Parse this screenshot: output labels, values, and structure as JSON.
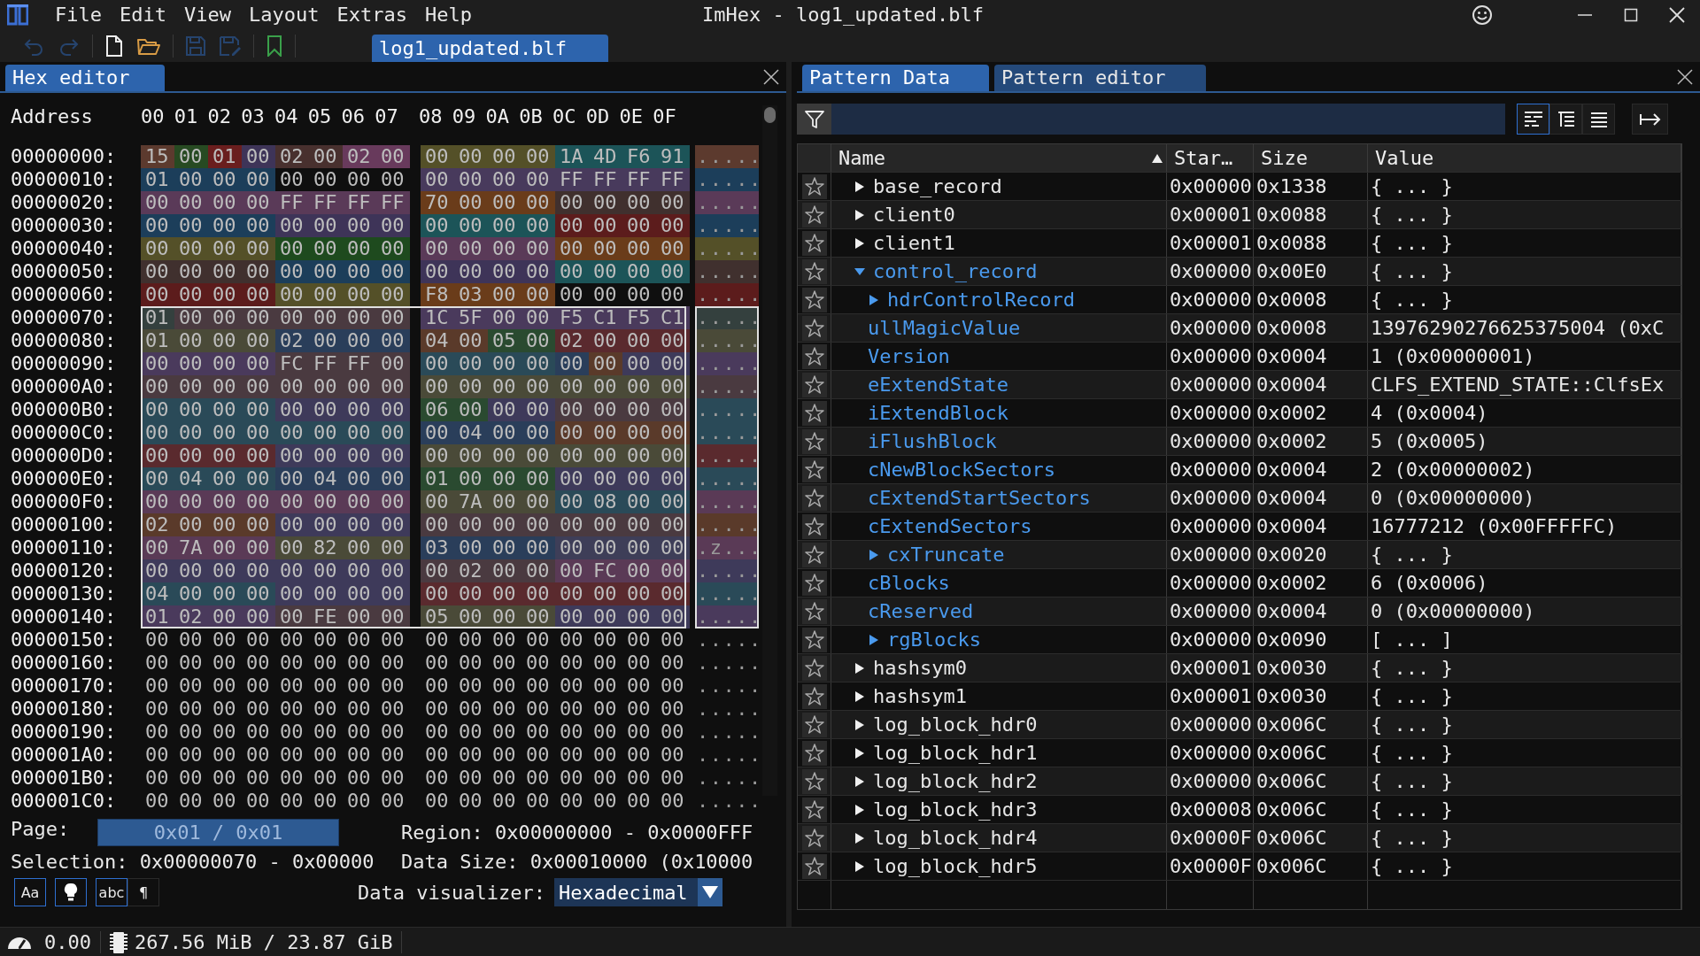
{
  "app": {
    "menu": [
      "File",
      "Edit",
      "View",
      "Layout",
      "Extras",
      "Help"
    ],
    "title": "ImHex - log1_updated.blf"
  },
  "toolbar": {
    "file_tab": "log1_updated.blf"
  },
  "hex_editor": {
    "tab": "Hex editor",
    "address_label": "Address",
    "columns": [
      "00",
      "01",
      "02",
      "03",
      "04",
      "05",
      "06",
      "07",
      "08",
      "09",
      "0A",
      "0B",
      "0C",
      "0D",
      "0E",
      "0F"
    ],
    "rows": [
      {
        "address": "00000000:",
        "selected": false,
        "ascii": ".....",
        "segments": [
          {
            "color": "#5c3a2e",
            "bytes": [
              "15"
            ]
          },
          {
            "color": "#274a22",
            "bytes": [
              "00"
            ]
          },
          {
            "color": "#6a1e1e",
            "bytes": [
              "01"
            ]
          },
          {
            "color": "#3e3458",
            "bytes": [
              "00"
            ]
          },
          {
            "color": "#48302e",
            "bytes": [
              "02",
              "00"
            ]
          },
          {
            "color": "#683a5c",
            "bytes": [
              "02",
              "00"
            ]
          },
          {
            "color": "#545028",
            "bytes": [
              "00",
              "00",
              "00",
              "00"
            ]
          },
          {
            "color": "#1c5458",
            "bytes": [
              "1A",
              "4D",
              "F6",
              "91"
            ]
          }
        ]
      },
      {
        "address": "00000010:",
        "selected": false,
        "ascii": ".....",
        "segments": [
          {
            "color": "#1c3e5a",
            "bytes": [
              "01",
              "00",
              "00",
              "00"
            ]
          },
          {
            "bytes": [
              "00",
              "00",
              "00",
              "00"
            ]
          },
          {
            "color": "#483a5c",
            "bytes": [
              "00",
              "00",
              "00",
              "00",
              "FF",
              "FF",
              "FF",
              "FF"
            ]
          }
        ]
      },
      {
        "address": "00000020:",
        "selected": false,
        "ascii": ".....",
        "segments": [
          {
            "color": "#5a3a58",
            "bytes": [
              "00",
              "00",
              "00",
              "00",
              "FF",
              "FF",
              "FF",
              "FF"
            ]
          },
          {
            "color": "#6a3c1a",
            "bytes": [
              "70",
              "00",
              "00",
              "00"
            ]
          },
          {
            "color": "#40302e",
            "bytes": [
              "00",
              "00",
              "00",
              "00"
            ]
          }
        ]
      },
      {
        "address": "00000030:",
        "selected": false,
        "ascii": ".....",
        "segments": [
          {
            "color": "#1c3e5a",
            "bytes": [
              "00",
              "00",
              "00",
              "00"
            ]
          },
          {
            "color": "#3e3458",
            "bytes": [
              "00",
              "00",
              "00",
              "00"
            ]
          },
          {
            "color": "#1c5458",
            "bytes": [
              "00",
              "00",
              "00",
              "00"
            ]
          },
          {
            "color": "#5c1c1c",
            "bytes": [
              "00",
              "00",
              "00",
              "00"
            ]
          }
        ]
      },
      {
        "address": "00000040:",
        "selected": false,
        "ascii": ".....",
        "segments": [
          {
            "color": "#545028",
            "bytes": [
              "00",
              "00",
              "00",
              "00"
            ]
          },
          {
            "color": "#1e4a1e",
            "bytes": [
              "00",
              "00",
              "00",
              "00"
            ]
          },
          {
            "color": "#5a3a58",
            "bytes": [
              "00",
              "00",
              "00",
              "00"
            ]
          },
          {
            "color": "#6a3c1a",
            "bytes": [
              "00",
              "00",
              "00",
              "00"
            ]
          }
        ]
      },
      {
        "address": "00000050:",
        "selected": false,
        "ascii": ".....",
        "segments": [
          {
            "color": "#40302e",
            "bytes": [
              "00",
              "00",
              "00",
              "00"
            ]
          },
          {
            "color": "#1c3e5a",
            "bytes": [
              "00",
              "00",
              "00",
              "00"
            ]
          },
          {
            "color": "#3e3458",
            "bytes": [
              "00",
              "00",
              "00",
              "00"
            ]
          },
          {
            "color": "#1c5458",
            "bytes": [
              "00",
              "00",
              "00",
              "00"
            ]
          }
        ]
      },
      {
        "address": "00000060:",
        "selected": false,
        "ascii": ".....",
        "segments": [
          {
            "color": "#5c1c1c",
            "bytes": [
              "00",
              "00",
              "00",
              "00"
            ]
          },
          {
            "color": "#545028",
            "bytes": [
              "00",
              "00",
              "00",
              "00"
            ]
          },
          {
            "color": "#6a3c1a",
            "bytes": [
              "F8",
              "03",
              "00",
              "00"
            ]
          },
          {
            "bytes": [
              "00",
              "00",
              "00",
              "00"
            ]
          }
        ]
      },
      {
        "address": "00000070:",
        "selected": true,
        "ascii": ".....",
        "segments": [
          {
            "color": "#34403e",
            "bytes": [
              "01"
            ]
          },
          {
            "color": "#4a3a40",
            "bytes": [
              "00",
              "00",
              "00",
              "00",
              "00",
              "00",
              "00"
            ]
          },
          {
            "color": "#4a3a5c",
            "bytes": [
              "1C",
              "5F",
              "00",
              "00",
              "F5",
              "C1",
              "F5",
              "C1"
            ]
          }
        ]
      },
      {
        "address": "00000080:",
        "selected": true,
        "ascii": ".....",
        "segments": [
          {
            "color": "#4a4a38",
            "bytes": [
              "01",
              "00",
              "00",
              "00"
            ]
          },
          {
            "color": "#2a3e5a",
            "bytes": [
              "02",
              "00",
              "00",
              "00"
            ]
          },
          {
            "color": "#5a3a2a",
            "bytes": [
              "04",
              "00"
            ]
          },
          {
            "color": "#2a4a30",
            "bytes": [
              "05",
              "00"
            ]
          },
          {
            "color": "#5a2a2e",
            "bytes": [
              "02",
              "00",
              "00",
              "00"
            ]
          }
        ]
      },
      {
        "address": "00000090:",
        "selected": true,
        "ascii": ".....",
        "segments": [
          {
            "color": "#4a3a5c",
            "bytes": [
              "00",
              "00",
              "00",
              "00"
            ]
          },
          {
            "color": "#4a3a40",
            "bytes": [
              "FC",
              "FF",
              "FF",
              "00"
            ]
          },
          {
            "color": "#2a4a58",
            "bytes": [
              "00",
              "00",
              "00",
              "00"
            ]
          },
          {
            "color": "#2a3e5a",
            "bytes": [
              "00"
            ]
          },
          {
            "color": "#5a3a2a",
            "bytes": [
              "00"
            ]
          },
          {
            "color": "#3e3a5a",
            "bytes": [
              "00",
              "00"
            ]
          }
        ]
      },
      {
        "address": "000000A0:",
        "selected": true,
        "ascii": ".....",
        "segments": [
          {
            "color": "#4a3a40",
            "bytes": [
              "00",
              "00",
              "00",
              "00",
              "00",
              "00",
              "00",
              "00"
            ]
          },
          {
            "color": "#4a4a38",
            "bytes": [
              "00",
              "00",
              "00",
              "00",
              "00",
              "00",
              "00",
              "00"
            ]
          }
        ]
      },
      {
        "address": "000000B0:",
        "selected": true,
        "ascii": ".....",
        "segments": [
          {
            "color": "#2a4a58",
            "bytes": [
              "00",
              "00",
              "00",
              "00"
            ]
          },
          {
            "color": "#3e3a5a",
            "bytes": [
              "00",
              "00",
              "00",
              "00"
            ]
          },
          {
            "color": "#2a4a30",
            "bytes": [
              "06",
              "00"
            ]
          },
          {
            "color": "#3e3a5a",
            "bytes": [
              "00",
              "00"
            ]
          },
          {
            "color": "#4a3a40",
            "bytes": [
              "00",
              "00",
              "00",
              "00"
            ]
          }
        ]
      },
      {
        "address": "000000C0:",
        "selected": true,
        "ascii": ".....",
        "segments": [
          {
            "color": "#2a4a58",
            "bytes": [
              "00",
              "00",
              "00",
              "00",
              "00",
              "00",
              "00",
              "00"
            ]
          },
          {
            "color": "#2a3e5a",
            "bytes": [
              "00",
              "04",
              "00",
              "00"
            ]
          },
          {
            "color": "#5a3a2a",
            "bytes": [
              "00",
              "00",
              "00",
              "00"
            ]
          }
        ]
      },
      {
        "address": "000000D0:",
        "selected": true,
        "ascii": ".....",
        "segments": [
          {
            "color": "#5a2a2e",
            "bytes": [
              "00",
              "00",
              "00",
              "00"
            ]
          },
          {
            "color": "#3e3a5a",
            "bytes": [
              "00",
              "00",
              "00",
              "00"
            ]
          },
          {
            "color": "#4a4a38",
            "bytes": [
              "00",
              "00",
              "00",
              "00",
              "00",
              "00",
              "00",
              "00"
            ]
          }
        ]
      },
      {
        "address": "000000E0:",
        "selected": true,
        "ascii": ".....",
        "segments": [
          {
            "color": "#2a4a58",
            "bytes": [
              "00",
              "04",
              "00",
              "00"
            ]
          },
          {
            "color": "#2a3e5a",
            "bytes": [
              "00",
              "04",
              "00",
              "00"
            ]
          },
          {
            "color": "#2a4a30",
            "bytes": [
              "01",
              "00",
              "00",
              "00"
            ]
          },
          {
            "color": "#3e3a5a",
            "bytes": [
              "00",
              "00",
              "00",
              "00"
            ]
          }
        ]
      },
      {
        "address": "000000F0:",
        "selected": true,
        "ascii": ".....",
        "segments": [
          {
            "color": "#5a3a56",
            "bytes": [
              "00",
              "00",
              "00",
              "00",
              "00",
              "00",
              "00",
              "00"
            ]
          },
          {
            "color": "#4a4a38",
            "bytes": [
              "00",
              "7A",
              "00",
              "00"
            ]
          },
          {
            "color": "#2a4a58",
            "bytes": [
              "00",
              "08",
              "00",
              "00"
            ]
          }
        ]
      },
      {
        "address": "00000100:",
        "selected": true,
        "ascii": ".....",
        "segments": [
          {
            "color": "#5a3a2a",
            "bytes": [
              "02",
              "00",
              "00",
              "00"
            ]
          },
          {
            "color": "#3e3a5a",
            "bytes": [
              "00",
              "00",
              "00",
              "00"
            ]
          },
          {
            "color": "#4a3a40",
            "bytes": [
              "00",
              "00",
              "00",
              "00",
              "00",
              "00",
              "00",
              "00"
            ]
          }
        ]
      },
      {
        "address": "00000110:",
        "selected": true,
        "ascii": ".z...",
        "segments": [
          {
            "color": "#5a3a56",
            "bytes": [
              "00",
              "7A",
              "00",
              "00"
            ]
          },
          {
            "color": "#4a4a38",
            "bytes": [
              "00",
              "82",
              "00",
              "00"
            ]
          },
          {
            "color": "#2a3e5a",
            "bytes": [
              "03",
              "00",
              "00",
              "00"
            ]
          },
          {
            "color": "#3e3e58",
            "bytes": [
              "00",
              "00",
              "00",
              "00"
            ]
          }
        ]
      },
      {
        "address": "00000120:",
        "selected": true,
        "ascii": ".....",
        "segments": [
          {
            "color": "#3e3a5a",
            "bytes": [
              "00",
              "00",
              "00",
              "00",
              "00",
              "00",
              "00",
              "00"
            ]
          },
          {
            "color": "#4a3a40",
            "bytes": [
              "00",
              "02",
              "00",
              "00"
            ]
          },
          {
            "color": "#5a3a56",
            "bytes": [
              "00",
              "FC",
              "00",
              "00"
            ]
          }
        ]
      },
      {
        "address": "00000130:",
        "selected": true,
        "ascii": ".....",
        "segments": [
          {
            "color": "#2a4a58",
            "bytes": [
              "04",
              "00",
              "00",
              "00"
            ]
          },
          {
            "color": "#3e3a5a",
            "bytes": [
              "00",
              "00",
              "00",
              "00"
            ]
          },
          {
            "color": "#5a2a2e",
            "bytes": [
              "00",
              "00",
              "00",
              "00",
              "00",
              "00",
              "00",
              "00"
            ]
          }
        ]
      },
      {
        "address": "00000140:",
        "selected": true,
        "ascii": ".....",
        "segments": [
          {
            "color": "#4a3a5c",
            "bytes": [
              "01",
              "02",
              "00",
              "00"
            ]
          },
          {
            "color": "#4a3a40",
            "bytes": [
              "00",
              "FE",
              "00",
              "00"
            ]
          },
          {
            "color": "#4a4a38",
            "bytes": [
              "05",
              "00",
              "00",
              "00"
            ]
          },
          {
            "color": "#3e3a5a",
            "bytes": [
              "00",
              "00",
              "00",
              "00"
            ]
          }
        ]
      },
      {
        "address": "00000150:",
        "selected": false,
        "ascii": ".....",
        "segments": [
          {
            "bytes": [
              "00",
              "00",
              "00",
              "00",
              "00",
              "00",
              "00",
              "00",
              "00",
              "00",
              "00",
              "00",
              "00",
              "00",
              "00",
              "00"
            ]
          }
        ]
      },
      {
        "address": "00000160:",
        "selected": false,
        "ascii": ".....",
        "segments": [
          {
            "bytes": [
              "00",
              "00",
              "00",
              "00",
              "00",
              "00",
              "00",
              "00",
              "00",
              "00",
              "00",
              "00",
              "00",
              "00",
              "00",
              "00"
            ]
          }
        ]
      },
      {
        "address": "00000170:",
        "selected": false,
        "ascii": ".....",
        "segments": [
          {
            "bytes": [
              "00",
              "00",
              "00",
              "00",
              "00",
              "00",
              "00",
              "00",
              "00",
              "00",
              "00",
              "00",
              "00",
              "00",
              "00",
              "00"
            ]
          }
        ]
      },
      {
        "address": "00000180:",
        "selected": false,
        "ascii": ".....",
        "segments": [
          {
            "bytes": [
              "00",
              "00",
              "00",
              "00",
              "00",
              "00",
              "00",
              "00",
              "00",
              "00",
              "00",
              "00",
              "00",
              "00",
              "00",
              "00"
            ]
          }
        ]
      },
      {
        "address": "00000190:",
        "selected": false,
        "ascii": ".....",
        "segments": [
          {
            "bytes": [
              "00",
              "00",
              "00",
              "00",
              "00",
              "00",
              "00",
              "00",
              "00",
              "00",
              "00",
              "00",
              "00",
              "00",
              "00",
              "00"
            ]
          }
        ]
      },
      {
        "address": "000001A0:",
        "selected": false,
        "ascii": ".....",
        "segments": [
          {
            "bytes": [
              "00",
              "00",
              "00",
              "00",
              "00",
              "00",
              "00",
              "00",
              "00",
              "00",
              "00",
              "00",
              "00",
              "00",
              "00",
              "00"
            ]
          }
        ]
      },
      {
        "address": "000001B0:",
        "selected": false,
        "ascii": ".....",
        "segments": [
          {
            "bytes": [
              "00",
              "00",
              "00",
              "00",
              "00",
              "00",
              "00",
              "00",
              "00",
              "00",
              "00",
              "00",
              "00",
              "00",
              "00",
              "00"
            ]
          }
        ]
      },
      {
        "address": "000001C0:",
        "selected": false,
        "ascii": ".....",
        "segments": [
          {
            "bytes": [
              "00",
              "00",
              "00",
              "00",
              "00",
              "00",
              "00",
              "00",
              "00",
              "00",
              "00",
              "00",
              "00",
              "00",
              "00",
              "00"
            ]
          }
        ]
      }
    ],
    "page_label": "Page:",
    "page_slider": {
      "text": "0x01 / 0x01",
      "level": 1
    },
    "region": "Region: 0x00000000 - 0x0000FFF",
    "selection": "Selection: 0x00000070 - 0x00000",
    "data_size": "Data Size: 0x00010000 (0x10000",
    "toggles": [
      {
        "kind": "text",
        "label": "Aa",
        "on": true
      },
      {
        "kind": "bulb",
        "on": true
      },
      {
        "kind": "text",
        "label": "abc",
        "on": true
      },
      {
        "kind": "text",
        "label": "¶",
        "on": false
      }
    ],
    "visualizer_label": "Data visualizer:",
    "visualizer": "Hexadecimal"
  },
  "pattern": {
    "tabs": [
      {
        "label": "Pattern Data",
        "selected": true
      },
      {
        "label": "Pattern editor",
        "selected": false
      }
    ],
    "columns": [
      "Name",
      "Star…",
      "Size",
      "Value"
    ],
    "items": [
      {
        "kind": "struct",
        "name": "base_record",
        "start": "0x00000",
        "size": "0x1338",
        "value": "{ ... }",
        "expanded": false,
        "highlighted": false
      },
      {
        "kind": "struct",
        "name": "client0",
        "start": "0x00001",
        "size": "0x0088",
        "value": "{ ... }",
        "expanded": false,
        "highlighted": false
      },
      {
        "kind": "struct",
        "name": "client1",
        "start": "0x00001",
        "size": "0x0088",
        "value": "{ ... }",
        "expanded": false,
        "highlighted": false
      },
      {
        "kind": "struct",
        "name": "control_record",
        "start": "0x00000",
        "size": "0x00E0",
        "value": "{ ... }",
        "expanded": true,
        "highlighted": true,
        "children": [
          {
            "kind": "struct",
            "name": "hdrControlRecord",
            "start": "0x00000",
            "size": "0x0008",
            "value": "{ ... }",
            "expanded": false,
            "highlighted": true
          },
          {
            "kind": "field",
            "name": "ullMagicValue",
            "start": "0x00000",
            "size": "0x0008",
            "value": "13976290276625375004 (0xC",
            "highlighted": true
          },
          {
            "kind": "field",
            "name": "Version",
            "start": "0x00000",
            "size": "0x0004",
            "value": "1 (0x00000001)",
            "highlighted": true
          },
          {
            "kind": "field",
            "name": "eExtendState",
            "start": "0x00000",
            "size": "0x0004",
            "value": "CLFS_EXTEND_STATE::ClfsEx",
            "highlighted": true
          },
          {
            "kind": "field",
            "name": "iExtendBlock",
            "start": "0x00000",
            "size": "0x0002",
            "value": "4 (0x0004)",
            "highlighted": true
          },
          {
            "kind": "field",
            "name": "iFlushBlock",
            "start": "0x00000",
            "size": "0x0002",
            "value": "5 (0x0005)",
            "highlighted": true
          },
          {
            "kind": "field",
            "name": "cNewBlockSectors",
            "start": "0x00000",
            "size": "0x0004",
            "value": "2 (0x00000002)",
            "highlighted": true
          },
          {
            "kind": "field",
            "name": "cExtendStartSectors",
            "start": "0x00000",
            "size": "0x0004",
            "value": "0 (0x00000000)",
            "highlighted": true
          },
          {
            "kind": "field",
            "name": "cExtendSectors",
            "start": "0x00000",
            "size": "0x0004",
            "value": "16777212 (0x00FFFFFC)",
            "highlighted": true
          },
          {
            "kind": "struct",
            "name": "cxTruncate",
            "start": "0x00000",
            "size": "0x0020",
            "value": "{ ... }",
            "expanded": false,
            "highlighted": true
          },
          {
            "kind": "field",
            "name": "cBlocks",
            "start": "0x00000",
            "size": "0x0002",
            "value": "6 (0x0006)",
            "highlighted": true
          },
          {
            "kind": "field",
            "name": "cReserved",
            "start": "0x00000",
            "size": "0x0004",
            "value": "0 (0x00000000)",
            "highlighted": true
          },
          {
            "kind": "struct",
            "name": "rgBlocks",
            "start": "0x00000",
            "size": "0x0090",
            "value": "[ ... ]",
            "expanded": false,
            "highlighted": true
          }
        ]
      },
      {
        "kind": "struct",
        "name": "hashsym0",
        "start": "0x00001",
        "size": "0x0030",
        "value": "{ ... }",
        "expanded": false,
        "highlighted": false
      },
      {
        "kind": "struct",
        "name": "hashsym1",
        "start": "0x00001",
        "size": "0x0030",
        "value": "{ ... }",
        "expanded": false,
        "highlighted": false
      },
      {
        "kind": "struct",
        "name": "log_block_hdr0",
        "start": "0x00000",
        "size": "0x006C",
        "value": "{ ... }",
        "expanded": false,
        "highlighted": false
      },
      {
        "kind": "struct",
        "name": "log_block_hdr1",
        "start": "0x00000",
        "size": "0x006C",
        "value": "{ ... }",
        "expanded": false,
        "highlighted": false
      },
      {
        "kind": "struct",
        "name": "log_block_hdr2",
        "start": "0x00000",
        "size": "0x006C",
        "value": "{ ... }",
        "expanded": false,
        "highlighted": false
      },
      {
        "kind": "struct",
        "name": "log_block_hdr3",
        "start": "0x00008",
        "size": "0x006C",
        "value": "{ ... }",
        "expanded": false,
        "highlighted": false
      },
      {
        "kind": "struct",
        "name": "log_block_hdr4",
        "start": "0x0000F",
        "size": "0x006C",
        "value": "{ ... }",
        "expanded": false,
        "highlighted": false
      },
      {
        "kind": "struct",
        "name": "log_block_hdr5",
        "start": "0x0000F",
        "size": "0x006C",
        "value": "{ ... }",
        "expanded": false,
        "highlighted": false
      }
    ]
  },
  "status_bar": {
    "fps": "0.00",
    "memory": "267.56 MiB / 23.87 GiB"
  }
}
